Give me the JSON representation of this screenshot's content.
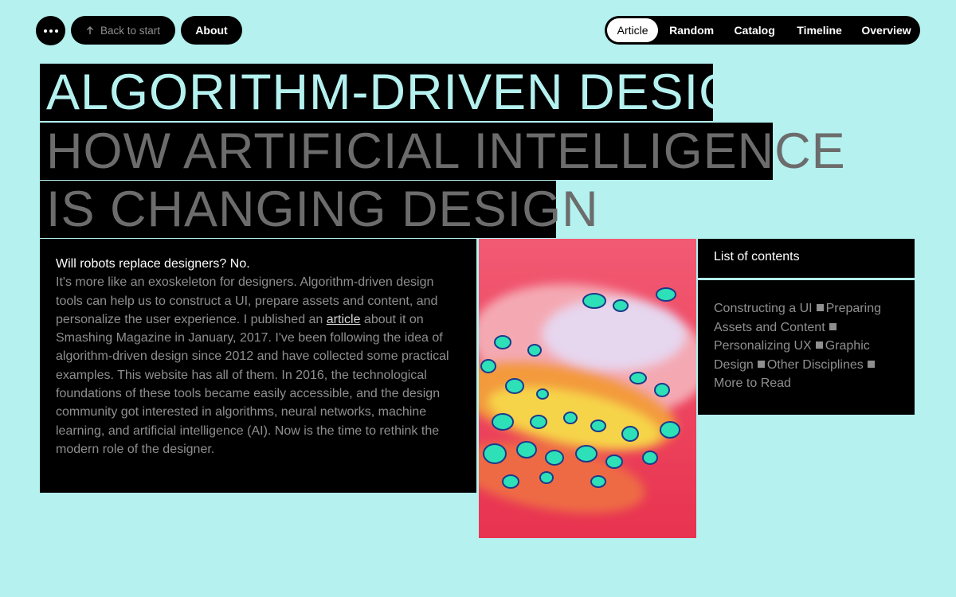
{
  "nav": {
    "back_label": "Back to start",
    "about_label": "About",
    "tabs": [
      {
        "label": "Article",
        "active": true
      },
      {
        "label": "Random",
        "active": false
      },
      {
        "label": "Catalog",
        "active": false
      },
      {
        "label": "Timeline",
        "active": false
      },
      {
        "label": "Overview",
        "active": false
      }
    ]
  },
  "headline": {
    "title": "ALGORITHM-DRIVEN DESIGN",
    "subtitle_line1": "HOW ARTIFICIAL INTELLIGENCE",
    "subtitle_line2": "IS CHANGING DESIGN"
  },
  "intro": {
    "question": "Will robots replace designers? No.",
    "body_before_link": "It's more like an exoskeleton for designers. Algorithm-driven design tools can help us to construct a UI, prepare assets and content, and personalize the user experience. I published an ",
    "link_text": "article",
    "body_after_link": " about it on Smashing Magazine in January, 2017. I've been following the idea of algorithm-driven design since 2012 and have collected some practical examples. This website has all of them. In 2016, the technological foundations of these tools became easily accessible, and the design community got interested in algorithms, neural networks, machine learning, and artificial intelligence (AI). Now is the time to rethink the modern role of the designer."
  },
  "toc": {
    "heading": "List of contents",
    "items": [
      "Constructing a UI",
      "Preparing Assets and Content",
      "Personalizing UX",
      "Graphic Design",
      "Other Disciplines",
      "More to Read"
    ]
  },
  "colors": {
    "background": "#b4f1ef",
    "panel": "#000000",
    "artwork_base": "#ec3e5a",
    "artwork_spots": "#2ee0b8"
  },
  "icons": {
    "menu": "more-dots-icon",
    "back": "arrow-up-icon"
  }
}
